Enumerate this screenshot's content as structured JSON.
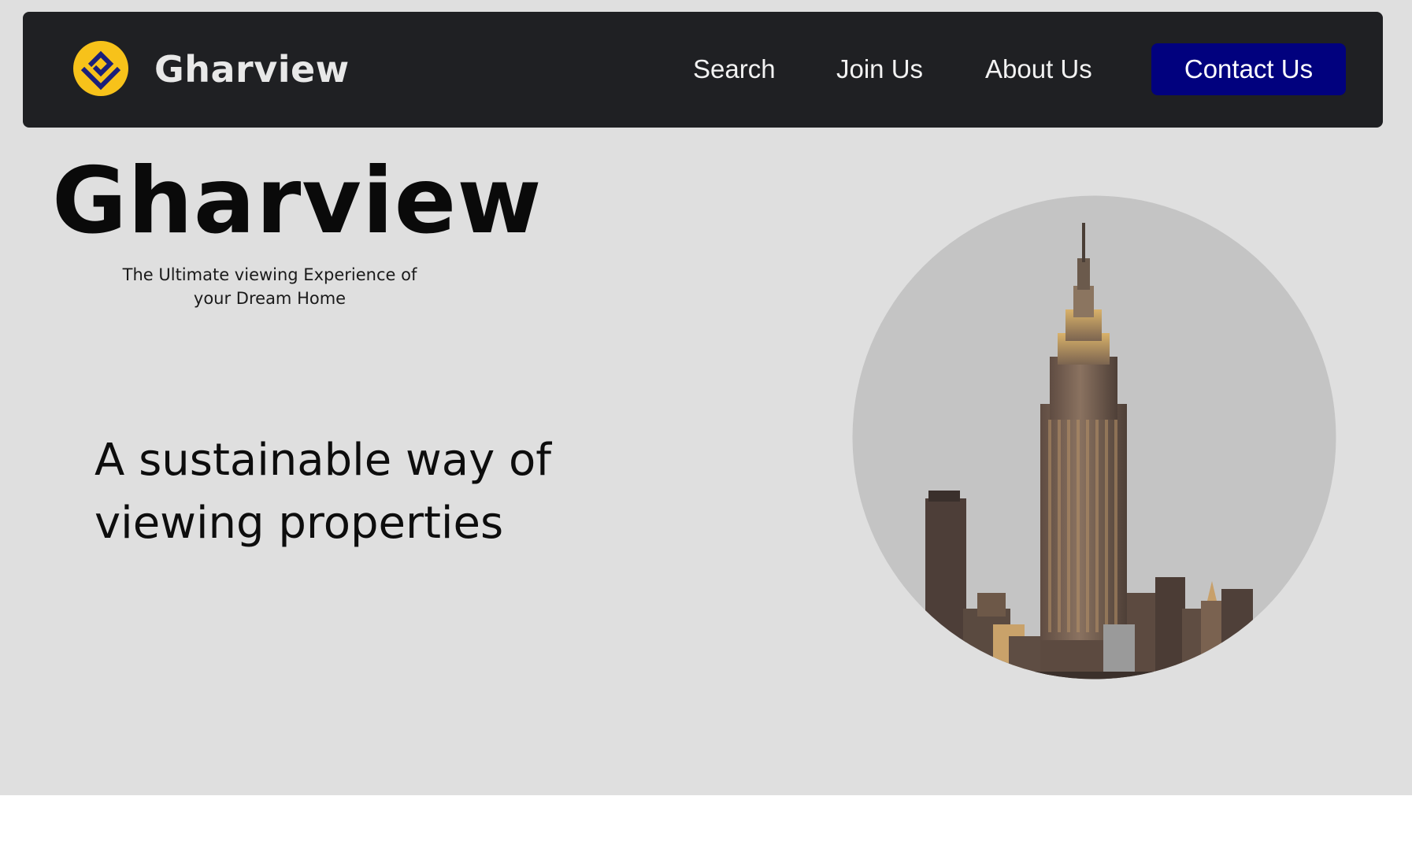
{
  "brand": {
    "name": "Gharview",
    "logo_icon": "diamond-logo-icon"
  },
  "nav": {
    "links": [
      "Search",
      "Join Us",
      "About Us"
    ],
    "contact_label": "Contact Us"
  },
  "hero": {
    "title": "Gharview",
    "subtitle": "The Ultimate viewing Experience of your Dream Home",
    "tagline": "A sustainable way of viewing properties",
    "image": "empire-state-building-skyline"
  },
  "colors": {
    "page_background": "#dfdfdf",
    "navbar_background": "#1f2023",
    "contact_button": "#01017e",
    "logo_yellow": "#f7c21a",
    "logo_mark": "#1a1f7a"
  }
}
